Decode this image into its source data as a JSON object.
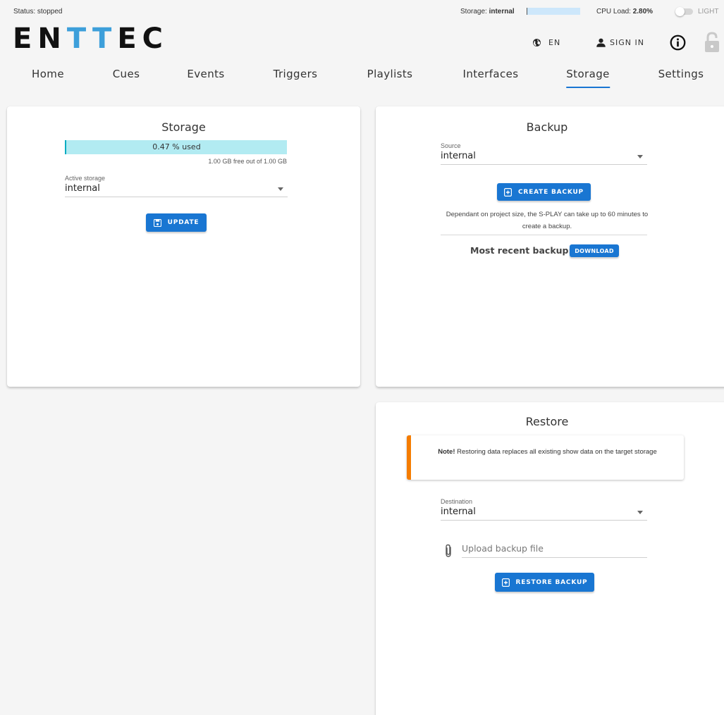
{
  "status": {
    "status_text": "Status: stopped",
    "storage_label": "Storage:",
    "storage_value": "internal",
    "cpu_label": "CPU Load:",
    "cpu_value": "2.80%",
    "theme_label": "LIGHT"
  },
  "header": {
    "logo": [
      "E",
      "N",
      "T",
      "T",
      "E",
      "C"
    ],
    "language_label": "EN",
    "signin_label": "SIGN IN",
    "info_icon": "info-icon",
    "lock_icon": "lock-icon"
  },
  "nav": {
    "tabs": [
      {
        "label": "Home"
      },
      {
        "label": "Cues"
      },
      {
        "label": "Events"
      },
      {
        "label": "Triggers"
      },
      {
        "label": "Playlists"
      },
      {
        "label": "Interfaces"
      },
      {
        "label": "Storage",
        "active": true
      },
      {
        "label": "Settings"
      }
    ]
  },
  "storage_card": {
    "title": "Storage",
    "usage_text": "0.47 % used",
    "usage_fraction": 0.0047,
    "free_text": "1.00 GB free out of 1.00 GB",
    "active_storage_label": "Active storage",
    "active_storage_value": "internal",
    "update_button": "UPDATE"
  },
  "backup_card": {
    "title": "Backup",
    "source_label": "Source",
    "source_value": "internal",
    "create_button": "CREATE BACKUP",
    "note": "Dependant on project size, the S-PLAY can take up to 60 minutes to create a backup.",
    "recent_label": "Most recent backup:",
    "download_button": "DOWNLOAD"
  },
  "restore_card": {
    "title": "Restore",
    "note_bold": "Note!",
    "note_text": " Restoring data replaces all existing show data on the target storage",
    "destination_label": "Destination",
    "destination_value": "internal",
    "upload_placeholder": "Upload backup file",
    "restore_button": "RESTORE BACKUP"
  },
  "colors": {
    "accent": "#1976d2",
    "logo_accent": "#3d9fda",
    "usage_bar": "#b2ebf2",
    "warning": "#f57c00"
  }
}
